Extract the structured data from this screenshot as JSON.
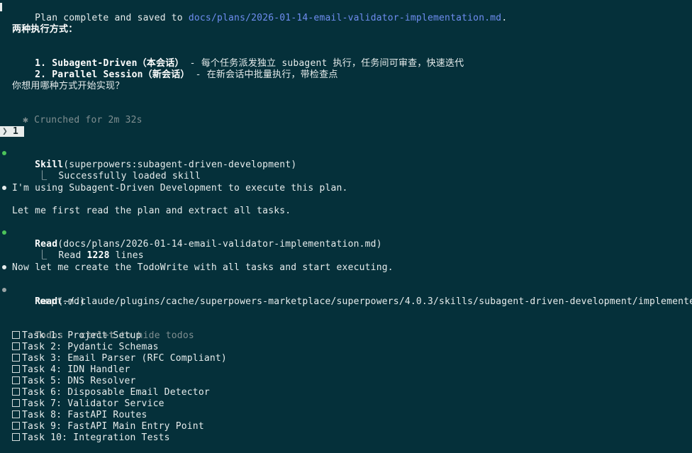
{
  "plan_complete": {
    "prefix": "Plan complete and saved to ",
    "path": "docs/plans/2026-01-14-email-validator-implementation.md",
    "suffix": "."
  },
  "options_heading": "两种执行方式：",
  "options": [
    {
      "num": "1.",
      "name": "Subagent-Driven（本会话）",
      "desc": " - 每个任务派发独立 subagent 执行，任务间可审查，快速迭代"
    },
    {
      "num": "2.",
      "name": "Parallel Session（新会话）",
      "desc": " - 在新会话中批量执行，带检查点"
    }
  ],
  "question": "你想用哪种方式开始实现？",
  "crunched": {
    "symbol": "✱",
    "text": "Crunched for 2m 32s"
  },
  "prompt": {
    "chevron": "❯",
    "input": "1"
  },
  "skill_call": {
    "name": "Skill",
    "args": "(superpowers:subagent-driven-development)",
    "result": "Successfully loaded skill"
  },
  "message1": "I'm using Subagent-Driven Development to execute this plan.",
  "message2": "Let me first read the plan and extract all tasks.",
  "read_call": {
    "name": "Read",
    "args": "(docs/plans/2026-01-14-email-validator-implementation.md)",
    "result_prefix": "Read ",
    "result_count": "1228",
    "result_suffix": " lines"
  },
  "message3": "Now let me create the TodoWrite with all tasks and start executing.",
  "read_call2": {
    "name": "Read",
    "args_line1": "(~/.claude/plugins/cache/superpowers-marketplace/superpowers/4.0.3/skills/subagent-driven-development/implementer-p",
    "args_line2": "rompt.md)"
  },
  "tree_glyph": "⎿",
  "todos": {
    "header_label": "Todos",
    "header_sep": " · ",
    "header_key": "ctrl+t",
    "header_hint": " to hide todos",
    "items": [
      "Task 1: Project Setup",
      "Task 2: Pydantic Schemas",
      "Task 3: Email Parser (RFC Compliant)",
      "Task 4: IDN Handler",
      "Task 5: DNS Resolver",
      "Task 6: Disposable Email Detector",
      "Task 7: Validator Service",
      "Task 8: FastAPI Routes",
      "Task 9: FastAPI Main Entry Point",
      "Task 10: Integration Tests"
    ]
  },
  "colors": {
    "background": "#05303a",
    "link": "#6f8df0",
    "success_bullet": "#4cc35a",
    "dim_text": "#7f8e90"
  }
}
